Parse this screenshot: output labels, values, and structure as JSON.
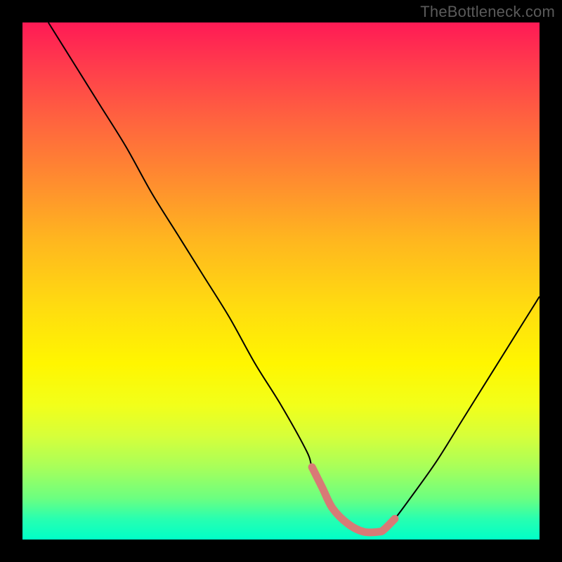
{
  "watermark": "TheBottleneck.com",
  "chart_data": {
    "type": "line",
    "title": "",
    "xlabel": "",
    "ylabel": "",
    "xlim": [
      0,
      100
    ],
    "ylim": [
      0,
      100
    ],
    "categories_note": "axes and tick labels are not rendered in the image; x/y values are estimated from pixel positions",
    "series": [
      {
        "name": "curve",
        "color": "#000000",
        "x": [
          5,
          10,
          15,
          20,
          25,
          30,
          35,
          40,
          45,
          50,
          55,
          56,
          58,
          60,
          63,
          66,
          69,
          70,
          72,
          75,
          80,
          85,
          90,
          95,
          100
        ],
        "y": [
          100,
          92,
          84,
          76,
          67,
          59,
          51,
          43,
          34,
          26,
          17,
          14,
          10,
          6,
          3,
          1.5,
          1.5,
          2,
          4,
          8,
          15,
          23,
          31,
          39,
          47
        ]
      }
    ],
    "highlight_segment": {
      "color": "#d87a76",
      "x_range": [
        56,
        72
      ],
      "note": "thicker salmon-colored segment near curve minimum"
    },
    "background": {
      "type": "vertical_gradient",
      "stops": [
        {
          "pos": 0.0,
          "color": "#ff1a55"
        },
        {
          "pos": 0.18,
          "color": "#ff6040"
        },
        {
          "pos": 0.42,
          "color": "#ffb61f"
        },
        {
          "pos": 0.66,
          "color": "#fff600"
        },
        {
          "pos": 0.86,
          "color": "#a8ff5a"
        },
        {
          "pos": 1.0,
          "color": "#00ffc8"
        }
      ]
    }
  }
}
